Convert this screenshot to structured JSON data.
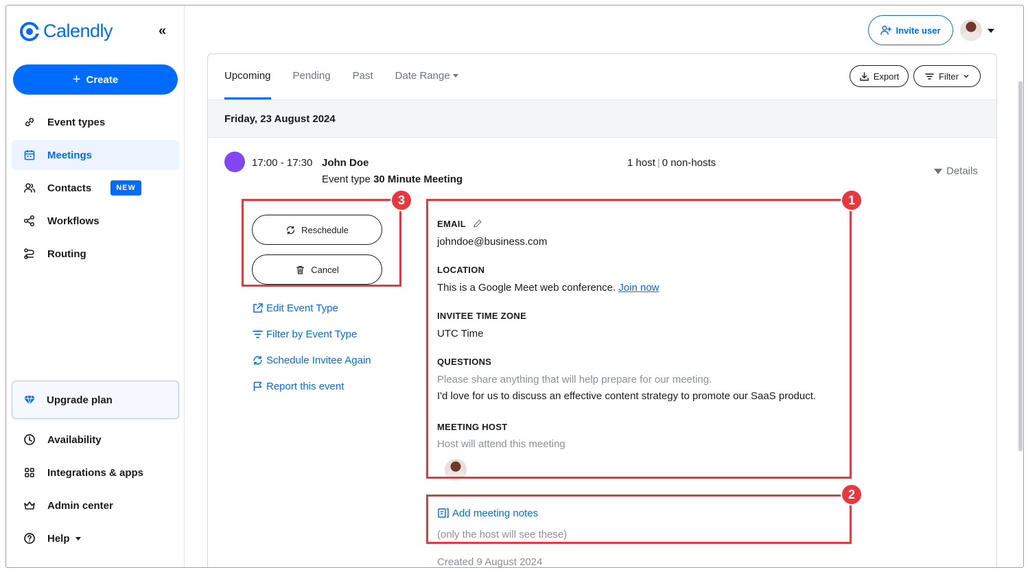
{
  "brand": {
    "name": "Calendly",
    "color": "#006bff"
  },
  "sidebar": {
    "collapse_icon": "«",
    "create_label": "Create",
    "items": [
      {
        "label": "Event types",
        "icon": "link-icon"
      },
      {
        "label": "Meetings",
        "icon": "calendar-icon",
        "active": true
      },
      {
        "label": "Contacts",
        "icon": "contacts-icon",
        "badge": "NEW"
      },
      {
        "label": "Workflows",
        "icon": "workflow-icon"
      },
      {
        "label": "Routing",
        "icon": "routing-icon"
      }
    ],
    "upgrade_label": "Upgrade plan",
    "bottom_items": [
      {
        "label": "Availability",
        "icon": "clock-icon"
      },
      {
        "label": "Integrations & apps",
        "icon": "grid-icon"
      },
      {
        "label": "Admin center",
        "icon": "crown-icon"
      },
      {
        "label": "Help",
        "icon": "help-icon"
      }
    ]
  },
  "topbar": {
    "invite_label": "Invite user"
  },
  "tabs": [
    {
      "label": "Upcoming",
      "active": true
    },
    {
      "label": "Pending"
    },
    {
      "label": "Past"
    },
    {
      "label": "Date Range"
    }
  ],
  "toolbar": {
    "export_label": "Export",
    "filter_label": "Filter"
  },
  "date_header": "Friday, 23 August 2024",
  "meeting": {
    "color": "#8247f5",
    "time": "17:00 - 17:30",
    "invitee": "John Doe",
    "event_type_prefix": "Event type",
    "event_type": "30 Minute Meeting",
    "hosts_count": "1 host",
    "hosts_sep": "|",
    "non_hosts": "0 non-hosts",
    "details_label": "Details",
    "reschedule_label": "Reschedule",
    "cancel_label": "Cancel",
    "links": {
      "edit_event_type": "Edit Event Type",
      "filter_by_event_type": "Filter by Event Type",
      "schedule_again": "Schedule Invitee Again",
      "report": "Report this event"
    },
    "email_label": "EMAIL",
    "email": "johndoe@business.com",
    "location_label": "LOCATION",
    "location_text": "This is a Google Meet web conference.",
    "join_label": "Join now",
    "timezone_label": "INVITEE TIME ZONE",
    "timezone": "UTC Time",
    "questions_label": "QUESTIONS",
    "question": "Please share anything that will help prepare for our meeting.",
    "answer": "I'd love for us to discuss an effective content strategy to promote our SaaS product.",
    "host_label": "MEETING HOST",
    "host_note": "Host will attend this meeting",
    "notes_label": "Add meeting notes",
    "notes_hint": "(only the host will see these)",
    "created": "Created 9 August 2024"
  },
  "annotations": {
    "one": "1",
    "two": "2",
    "three": "3",
    "color": "#e8383d"
  }
}
